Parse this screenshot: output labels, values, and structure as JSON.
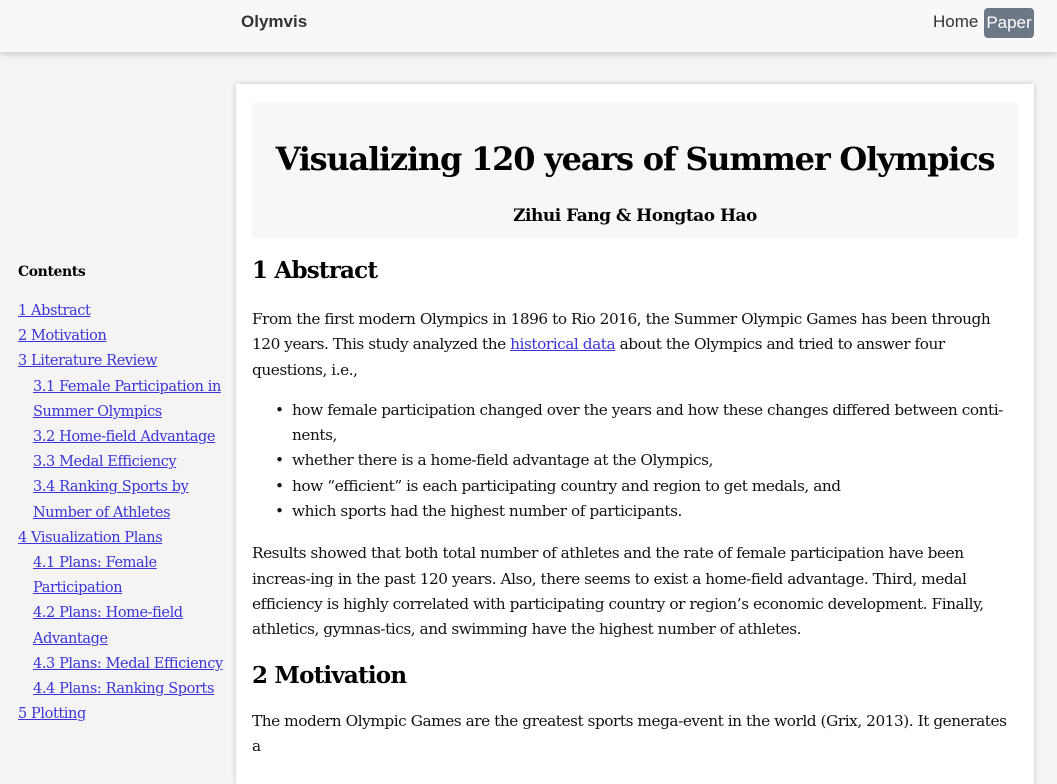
{
  "navbar": {
    "brand": "Olymvis",
    "home_label": "Home",
    "paper_label": "Paper"
  },
  "toc": {
    "heading": "Contents",
    "items": [
      {
        "label": "1 Abstract",
        "level": 1
      },
      {
        "label": "2 Motivation",
        "level": 1
      },
      {
        "label": "3 Literature Review",
        "level": 1
      },
      {
        "label": "3.1 Female Participation in Summer Olympics",
        "level": 2
      },
      {
        "label": "3.2 Home-field Advantage",
        "level": 2
      },
      {
        "label": "3.3 Medal Efficiency",
        "level": 2
      },
      {
        "label": "3.4 Ranking Sports by Number of Athletes",
        "level": 2
      },
      {
        "label": "4 Visualization Plans",
        "level": 1
      },
      {
        "label": "4.1 Plans: Female Participation",
        "level": 2
      },
      {
        "label": "4.2 Plans: Home-field Advantage",
        "level": 2
      },
      {
        "label": "4.3 Plans: Medal Efficiency",
        "level": 2
      },
      {
        "label": "4.4 Plans: Ranking Sports",
        "level": 2
      },
      {
        "label": "5 Plotting",
        "level": 1
      }
    ]
  },
  "paper": {
    "title": "Visualizing 120 years of Summer Olympics",
    "authors": "Zihui Fang & Hongtao Hao",
    "abstract_heading": "1 Abstract",
    "abstract_p1_before": "From the first modern Olympics in 1896 to Rio 2016, the Summer Olympic Games has been through 120 years. This study analyzed the ",
    "abstract_p1_link": "historical data",
    "abstract_p1_after": " about the Olympics and tried to answer four questions, i.e.,",
    "bullet_char": "•",
    "bullets": [
      "how female participation changed over the years and how these changes differed between conti-nents,",
      "whether there is a home-field advantage at the Olympics,",
      "how “efficient” is each participating country and region to get medals, and",
      "which sports had the highest number of participants."
    ],
    "abstract_p2": "Results showed that both total number of athletes and the rate of female participation have been increas-ing in the past 120 years. Also, there seems to exist a home-field advantage. Third, medal efficiency is highly correlated with participating country or region’s economic development. Finally, athletics, gymnas-tics, and swimming have the highest number of athletes.",
    "motivation_heading": "2 Motivation",
    "motivation_p1": "The modern Olympic Games are the greatest sports mega-event in the world (Grix, 2013). It generates a"
  },
  "colors": {
    "link": "#3c33d8",
    "paper_button_bg": "#6c7886",
    "navbar_bg": "#f8f8f8",
    "page_bg": "#f4f4f4"
  }
}
